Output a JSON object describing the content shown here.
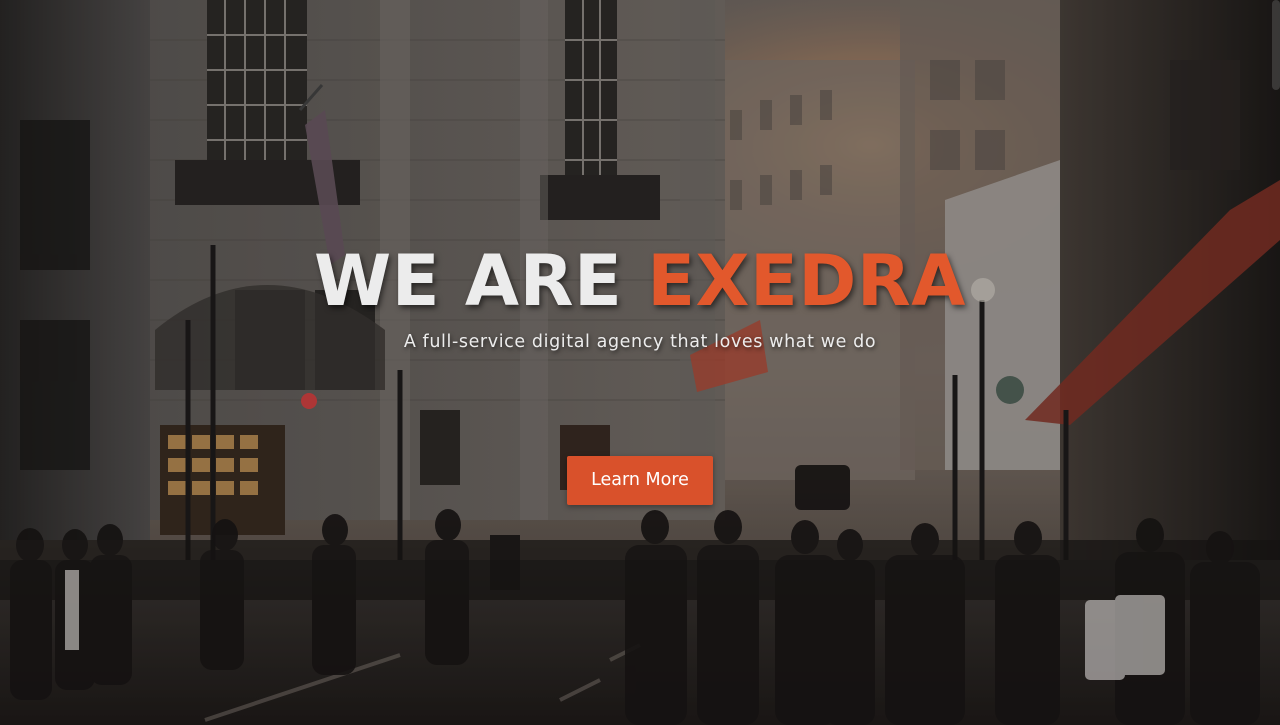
{
  "hero": {
    "headline_part1": "WE ARE ",
    "headline_part2": "EXEDRA",
    "tagline": "A full-service digital agency that loves what we do",
    "cta_label": "Learn More"
  },
  "colors": {
    "accent": "#d9512b",
    "headline_accent": "#e2582c",
    "text_light": "#ececec"
  }
}
